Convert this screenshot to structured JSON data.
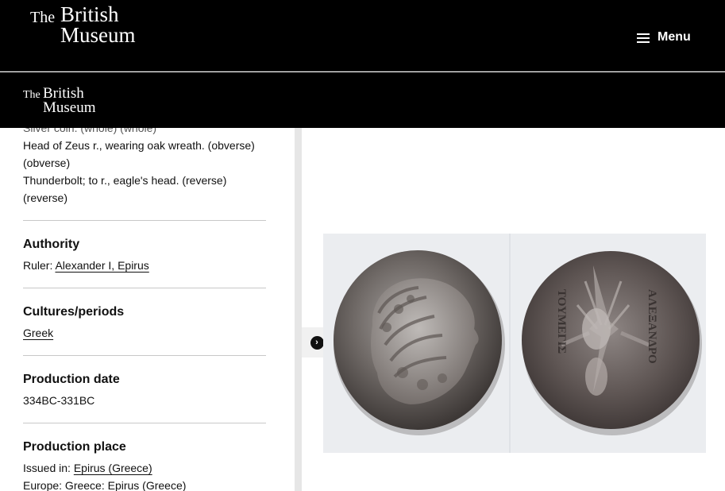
{
  "header": {
    "logo": {
      "the": "The",
      "british": "British",
      "museum": "Museum"
    },
    "menu_label": "Menu"
  },
  "sticky_header": {
    "logo": {
      "the": "The",
      "british": "British",
      "museum": "Museum"
    }
  },
  "description": {
    "cut_line": "Silver coin. (whole) (whole)",
    "lines": [
      "Head of Zeus r., wearing oak wreath. (obverse)",
      "(obverse)",
      "Thunderbolt; to r., eagle's head. (reverse)",
      "(reverse)"
    ]
  },
  "sections": {
    "authority": {
      "title": "Authority",
      "prefix": "Ruler: ",
      "link": "Alexander I, Epirus"
    },
    "cultures": {
      "title": "Cultures/periods",
      "link": "Greek"
    },
    "production_date": {
      "title": "Production date",
      "value": "334BC-331BC"
    },
    "production_place": {
      "title": "Production place",
      "prefix": "Issued in: ",
      "link": "Epirus (Greece)",
      "line2": "Europe: Greece: Epirus (Greece)"
    }
  },
  "toggle": {
    "icon": "chevron-right-icon",
    "glyph": "›"
  },
  "coin_inscription": {
    "reverse_left": "ΤΟΥΜΕΓΙΣ",
    "reverse_right": "ΑΛΕΞΑΝΔΡΟ"
  },
  "colors": {
    "header_bg": "#000000",
    "divider": "#e6e6e6",
    "image_bg": "#ebedf0"
  }
}
